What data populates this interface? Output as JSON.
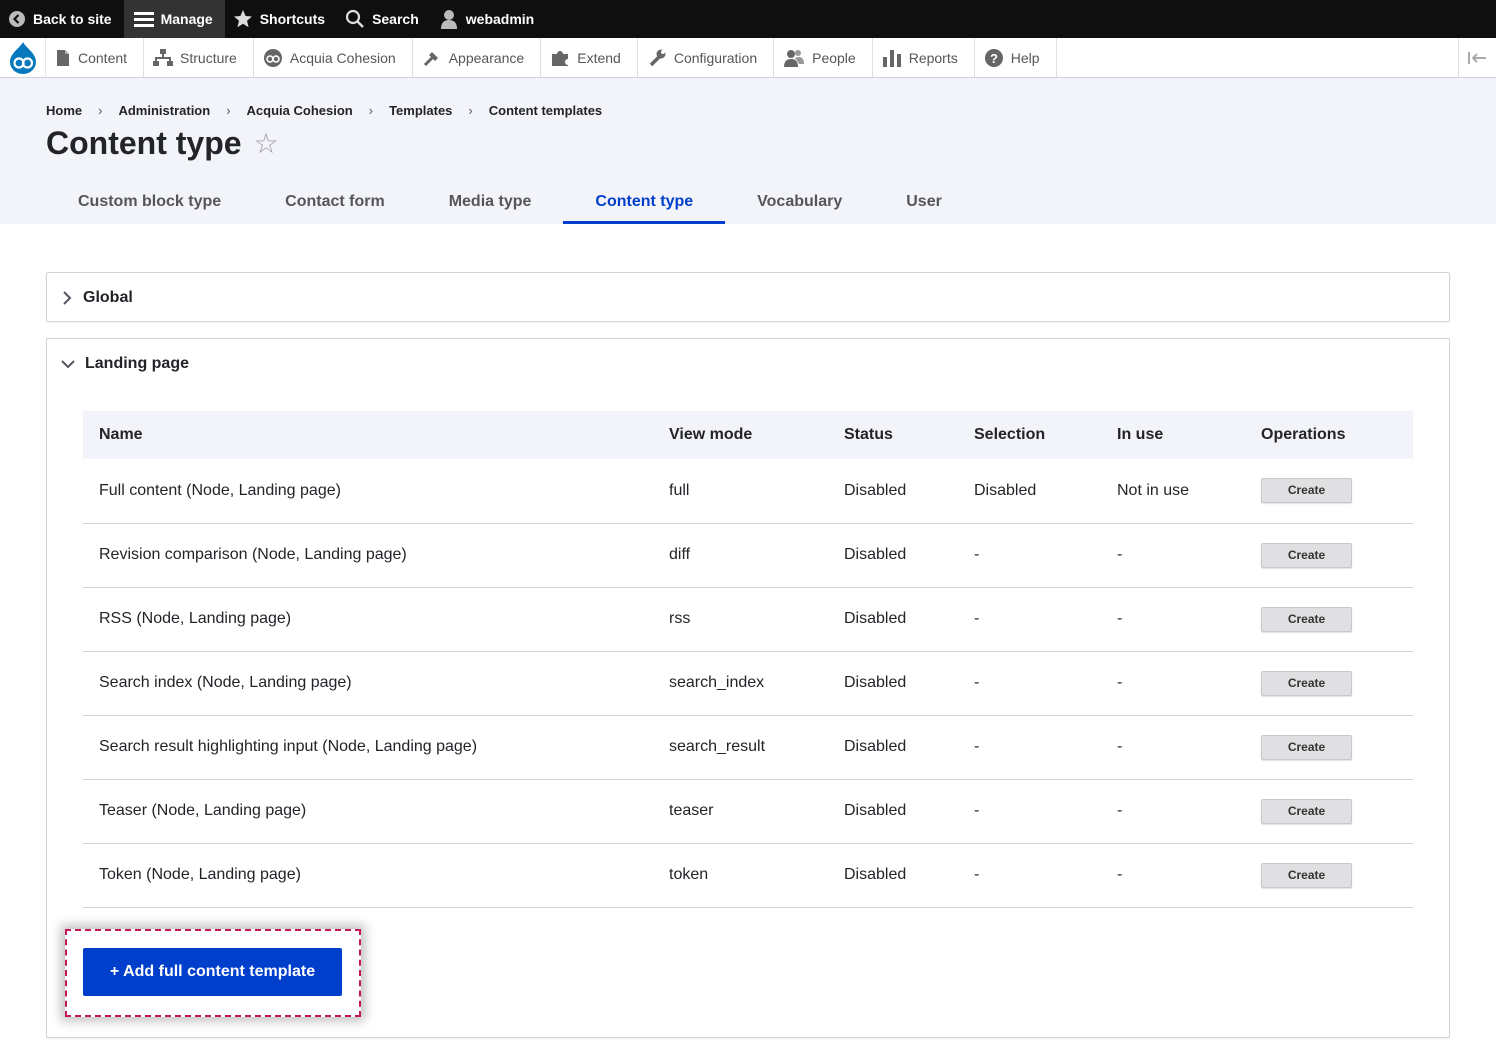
{
  "toolbar": {
    "back_to_site": "Back to site",
    "manage": "Manage",
    "shortcuts": "Shortcuts",
    "search": "Search",
    "user": "webadmin"
  },
  "tray": {
    "items": [
      {
        "label": "Content",
        "icon": "file-icon"
      },
      {
        "label": "Structure",
        "icon": "sitemap-icon"
      },
      {
        "label": "Acquia Cohesion",
        "icon": "cohesion-icon"
      },
      {
        "label": "Appearance",
        "icon": "paintbrush-icon"
      },
      {
        "label": "Extend",
        "icon": "puzzle-icon"
      },
      {
        "label": "Configuration",
        "icon": "wrench-icon"
      },
      {
        "label": "People",
        "icon": "people-icon"
      },
      {
        "label": "Reports",
        "icon": "bar-chart-icon"
      },
      {
        "label": "Help",
        "icon": "help-icon"
      }
    ]
  },
  "breadcrumb": [
    "Home",
    "Administration",
    "Acquia Cohesion",
    "Templates",
    "Content templates"
  ],
  "page_title": "Content type",
  "tabs": [
    {
      "label": "Custom block type",
      "active": false
    },
    {
      "label": "Contact form",
      "active": false
    },
    {
      "label": "Media type",
      "active": false
    },
    {
      "label": "Content type",
      "active": true
    },
    {
      "label": "Vocabulary",
      "active": false
    },
    {
      "label": "User",
      "active": false
    }
  ],
  "sections": {
    "global": {
      "title": "Global",
      "expanded": false
    },
    "landing": {
      "title": "Landing page",
      "expanded": true
    }
  },
  "table": {
    "headers": [
      "Name",
      "View mode",
      "Status",
      "Selection",
      "In use",
      "Operations"
    ],
    "rows": [
      [
        "Full content (Node, Landing page)",
        "full",
        "Disabled",
        "Disabled",
        "Not in use",
        "Create"
      ],
      [
        "Revision comparison (Node, Landing page)",
        "diff",
        "Disabled",
        "-",
        "-",
        "Create"
      ],
      [
        "RSS (Node, Landing page)",
        "rss",
        "Disabled",
        "-",
        "-",
        "Create"
      ],
      [
        "Search index (Node, Landing page)",
        "search_index",
        "Disabled",
        "-",
        "-",
        "Create"
      ],
      [
        "Search result highlighting input (Node, Landing page)",
        "search_result",
        "Disabled",
        "-",
        "-",
        "Create"
      ],
      [
        "Teaser (Node, Landing page)",
        "teaser",
        "Disabled",
        "-",
        "-",
        "Create"
      ],
      [
        "Token (Node, Landing page)",
        "token",
        "Disabled",
        "-",
        "-",
        "Create"
      ]
    ]
  },
  "add_button": "+ Add full content template",
  "colors": {
    "accent": "#003ecc",
    "toolbar": "#0f0f0f",
    "header_bg": "#f3f4f9",
    "highlight": "#c2185b"
  }
}
